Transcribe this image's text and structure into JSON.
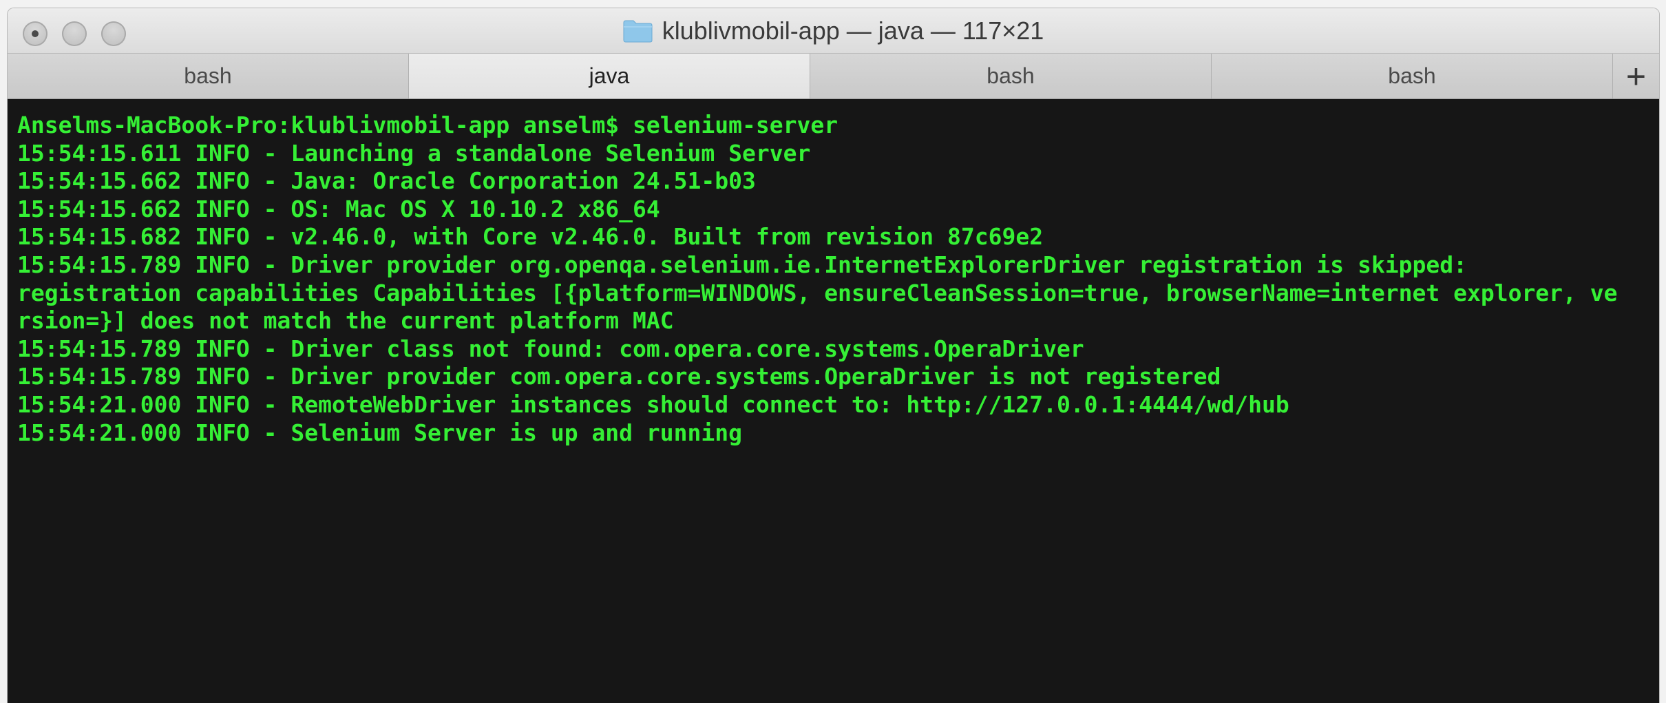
{
  "window": {
    "title": "klublivmobil-app — java — 117×21",
    "folder_icon": "folder-icon",
    "folder_color": "#8fc7ea"
  },
  "tabs": [
    {
      "label": "bash",
      "active": false
    },
    {
      "label": "java",
      "active": true
    },
    {
      "label": "bash",
      "active": false
    },
    {
      "label": "bash",
      "active": false
    }
  ],
  "new_tab_label": "+",
  "terminal": {
    "text_color": "#35f035",
    "background": "#161616",
    "lines": [
      "Anselms-MacBook-Pro:klublivmobil-app anselm$ selenium-server",
      "15:54:15.611 INFO - Launching a standalone Selenium Server",
      "15:54:15.662 INFO - Java: Oracle Corporation 24.51-b03",
      "15:54:15.662 INFO - OS: Mac OS X 10.10.2 x86_64",
      "15:54:15.682 INFO - v2.46.0, with Core v2.46.0. Built from revision 87c69e2",
      "15:54:15.789 INFO - Driver provider org.openqa.selenium.ie.InternetExplorerDriver registration is skipped:",
      "registration capabilities Capabilities [{platform=WINDOWS, ensureCleanSession=true, browserName=internet explorer, ve",
      "rsion=}] does not match the current platform MAC",
      "15:54:15.789 INFO - Driver class not found: com.opera.core.systems.OperaDriver",
      "15:54:15.789 INFO - Driver provider com.opera.core.systems.OperaDriver is not registered",
      "15:54:21.000 INFO - RemoteWebDriver instances should connect to: http://127.0.0.1:4444/wd/hub",
      "15:54:21.000 INFO - Selenium Server is up and running"
    ]
  }
}
